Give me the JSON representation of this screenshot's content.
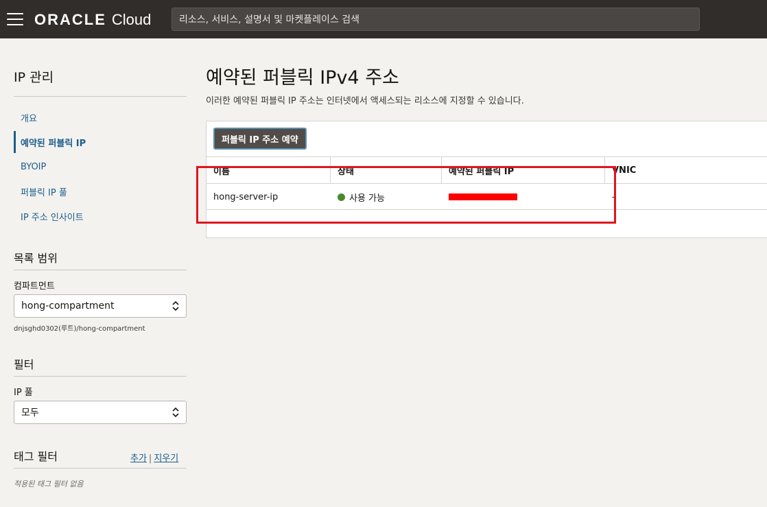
{
  "header": {
    "brand_oracle": "ORACLE",
    "brand_cloud": "Cloud",
    "search_placeholder": "리소스, 서비스, 설명서 및 마켓플레이스 검색"
  },
  "sidebar": {
    "title": "IP 관리",
    "items": [
      {
        "label": "개요",
        "active": false
      },
      {
        "label": "예약된 퍼블릭 IP",
        "active": true
      },
      {
        "label": "BYOIP",
        "active": false
      },
      {
        "label": "퍼블릭 IP 풀",
        "active": false
      },
      {
        "label": "IP 주소 인사이트",
        "active": false
      }
    ],
    "scope": {
      "title": "목록 범위",
      "compartment_label": "컴파트먼트",
      "compartment_value": "hong-compartment",
      "compartment_path": "dnjsghd0302(루트)/hong-compartment"
    },
    "filter": {
      "title": "필터",
      "ip_pool_label": "IP 풀",
      "ip_pool_value": "모두"
    },
    "tag_filter": {
      "title": "태그 필터",
      "add_label": "추가",
      "separator": "|",
      "clear_label": "지우기",
      "empty_note": "적용된 태그 필터 없음"
    }
  },
  "main": {
    "title": "예약된 퍼블릭 IPv4 주소",
    "description": "이러한 예약된 퍼블릭 IP 주소는 인터넷에서 액세스되는 리소스에 지정할 수 있습니다.",
    "reserve_button": "퍼블릭 IP 주소 예약",
    "table": {
      "columns": [
        "이름",
        "상태",
        "예약된 퍼블릭 IP",
        "VNIC"
      ],
      "rows": [
        {
          "name": "hong-server-ip",
          "status": "사용 가능",
          "ip": "",
          "vnic": "-"
        }
      ]
    }
  },
  "colors": {
    "header_bg": "#312d2a",
    "link": "#1c5d8c",
    "status_available": "#4a8a2a",
    "highlight": "#e0141e",
    "redaction": "#ff0000"
  }
}
